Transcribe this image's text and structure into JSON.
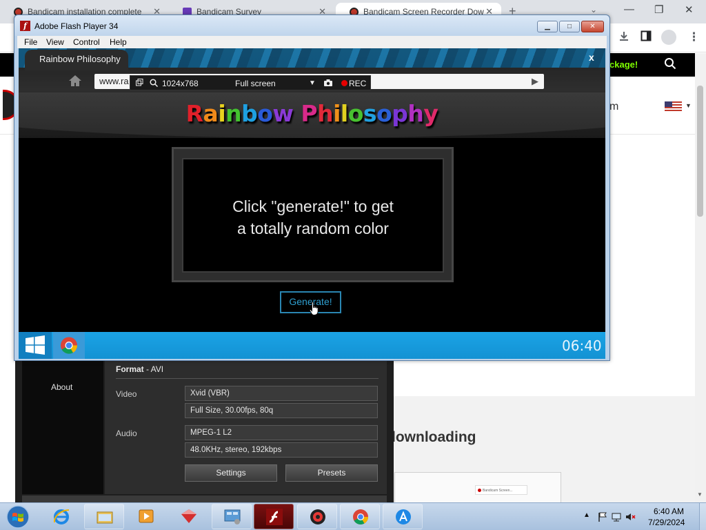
{
  "chrome": {
    "tabs": [
      {
        "title": "Bandicam installation complete"
      },
      {
        "title": "Bandicam Survey"
      },
      {
        "title": "Bandicam Screen Recorder Dow"
      }
    ],
    "new_tab": "+",
    "tab_close": "✕",
    "tab_search": "⌄",
    "window_controls": {
      "minimize": "—",
      "restore": "❐",
      "close": "✕"
    },
    "menu": "⋮"
  },
  "website": {
    "banner_text": "ckage!",
    "nav_fragment": "m",
    "heading": "lownloading",
    "thumb_tab": "Bandicam Screen..."
  },
  "flash_player": {
    "title": "Adobe Flash Player 34",
    "menu": {
      "file": "File",
      "view": "View",
      "control": "Control",
      "help": "Help"
    },
    "controls": {
      "minimize": "▁",
      "maximize": "□",
      "close": "✕"
    }
  },
  "rainbow_philosophy": {
    "tab_title": "Rainbow Philosophy",
    "close": "x",
    "url": "www.ra",
    "go": "▶",
    "logo_letters": [
      "R",
      "a",
      "i",
      "n",
      "b",
      "o",
      "w",
      " ",
      "P",
      "h",
      "i",
      "l",
      "o",
      "s",
      "o",
      "p",
      "h",
      "y"
    ],
    "logo_colors": [
      "#e0202a",
      "#f08a1a",
      "#e8d21e",
      "#43c22f",
      "#1e9fe0",
      "#2a5ad8",
      "#8a3ad6",
      "#000000",
      "#d82a8a",
      "#e02a3a",
      "#f0901a",
      "#e0d020",
      "#48c030",
      "#22a0e0",
      "#2a60d8",
      "#7a36d6",
      "#b030c0",
      "#e02a6a"
    ],
    "message_line1": "Click \"generate!\" to get",
    "message_line2": "a totally random color",
    "generate_button": "Generate!",
    "clock": "06:40"
  },
  "bandicam_recbar": {
    "resolution": "1024x768",
    "mode": "Full screen",
    "rec": "REC"
  },
  "bandicam": {
    "sidebar_about": "About",
    "format_label": "Format",
    "format_value": " - AVI",
    "video_label": "Video",
    "video_codec": "Xvid (VBR)",
    "video_detail": "Full Size, 30.00fps, 80q",
    "audio_label": "Audio",
    "audio_codec": "MPEG-1 L2",
    "audio_detail": "48.0KHz, stereo, 192kbps",
    "settings_button": "Settings",
    "presets_button": "Presets"
  },
  "taskbar": {
    "time": "6:40 AM",
    "date": "7/29/2024",
    "tray_chevron": "▲"
  },
  "colors": {
    "chrome_tabstrip": "#dee1e6",
    "flash_titlebar": "#c0d5ec",
    "generate_accent": "#2e9fd0",
    "fake_taskbar": "#1ba3e6",
    "rec_dot": "#e60000",
    "banner_accent": "#7fff00"
  }
}
